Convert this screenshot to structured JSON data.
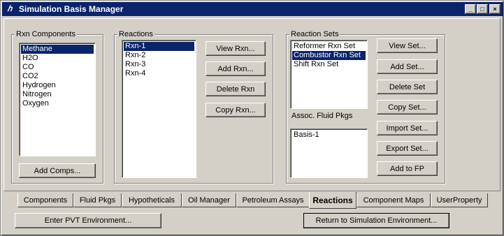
{
  "window": {
    "title": "Simulation Basis Manager",
    "icon": "hysys-app-icon",
    "controls": {
      "minimize": "_",
      "maximize": "□",
      "close": "×"
    }
  },
  "rxn_components": {
    "legend": "Rxn Components",
    "items": [
      "Methane",
      "H2O",
      "CO",
      "CO2",
      "Hydrogen",
      "Nitrogen",
      "Oxygen"
    ],
    "selected_index": 0,
    "add_button": "Add Comps..."
  },
  "reactions": {
    "legend": "Reactions",
    "items": [
      "Rxn-1",
      "Rxn-2",
      "Rxn-3",
      "Rxn-4"
    ],
    "selected_index": 0,
    "buttons": {
      "view": "View Rxn...",
      "add": "Add Rxn...",
      "delete": "Delete Rxn",
      "copy": "Copy Rxn..."
    }
  },
  "reaction_sets": {
    "legend": "Reaction Sets",
    "items": [
      "Reformer Rxn Set",
      "Combustor Rxn Set",
      "Shift Rxn Set"
    ],
    "selected_index": 1,
    "assoc_label": "Assoc. Fluid Pkgs",
    "assoc_items": [
      "Basis-1"
    ],
    "buttons": {
      "view": "View Set...",
      "add": "Add Set...",
      "delete": "Delete Set",
      "copy": "Copy Set...",
      "import": "Import Set...",
      "export": "Export Set...",
      "add_to_fp": "Add to FP"
    }
  },
  "tabs": [
    {
      "label": "Components"
    },
    {
      "label": "Fluid Pkgs"
    },
    {
      "label": "Hypotheticals"
    },
    {
      "label": "Oil Manager"
    },
    {
      "label": "Petroleum Assays"
    },
    {
      "label": "Reactions"
    },
    {
      "label": "Component Maps"
    },
    {
      "label": "UserProperty"
    }
  ],
  "active_tab": "Reactions",
  "footer": {
    "enter_pvt": "Enter PVT Environment...",
    "return_sim": "Return to Simulation Environment..."
  },
  "colors": {
    "face": "#d4d0c8",
    "title_bar": "#0a246a",
    "selection": "#0a246a"
  }
}
